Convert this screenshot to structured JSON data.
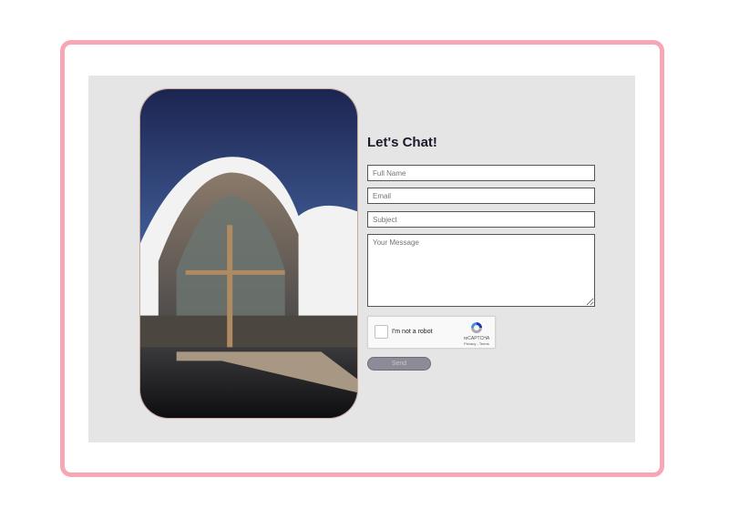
{
  "contact": {
    "heading": "Let's Chat!",
    "full_name_placeholder": "Full Name",
    "email_placeholder": "Email",
    "subject_placeholder": "Subject",
    "message_placeholder": "Your Message",
    "captcha_label": "I'm not a robot",
    "captcha_brand": "reCAPTCHA",
    "captcha_terms": "Privacy - Terms",
    "send_label": "Send"
  },
  "colors": {
    "frame": "#f7a6b5",
    "panel": "#e5e5e5",
    "button": "#8c8c98"
  }
}
